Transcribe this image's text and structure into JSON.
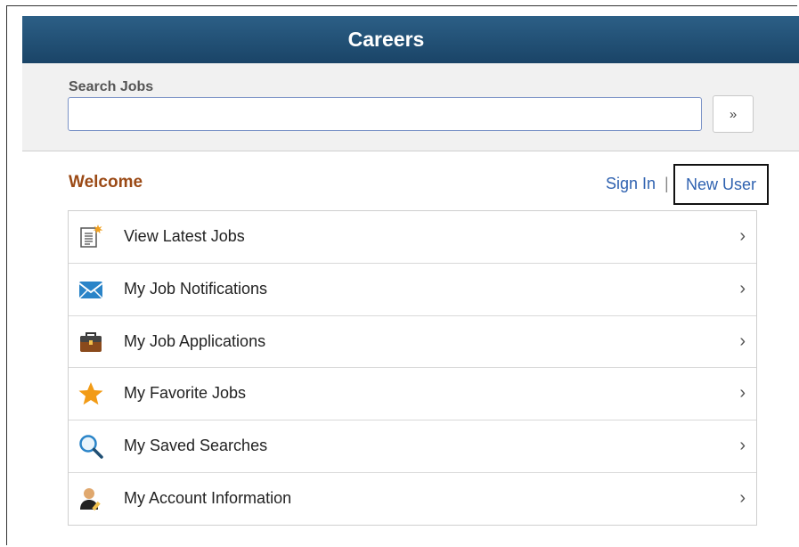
{
  "header": {
    "title": "Careers"
  },
  "search": {
    "label": "Search Jobs",
    "value": "",
    "placeholder": "",
    "button_glyph": "»"
  },
  "welcome": {
    "title": "Welcome",
    "sign_in": "Sign In",
    "separator": "|",
    "new_user": "New User"
  },
  "menu": {
    "chevron": "›",
    "items": [
      {
        "label": "View Latest Jobs",
        "icon": "document-new-icon"
      },
      {
        "label": "My Job Notifications",
        "icon": "envelope-icon"
      },
      {
        "label": "My Job Applications",
        "icon": "briefcase-icon"
      },
      {
        "label": "My Favorite Jobs",
        "icon": "star-icon"
      },
      {
        "label": "My Saved Searches",
        "icon": "magnifier-icon"
      },
      {
        "label": "My Account Information",
        "icon": "user-edit-icon"
      }
    ]
  },
  "colors": {
    "banner": "#1f4e73",
    "welcome": "#9b4a16",
    "link": "#2f62b0",
    "highlight_border": "#111111"
  }
}
